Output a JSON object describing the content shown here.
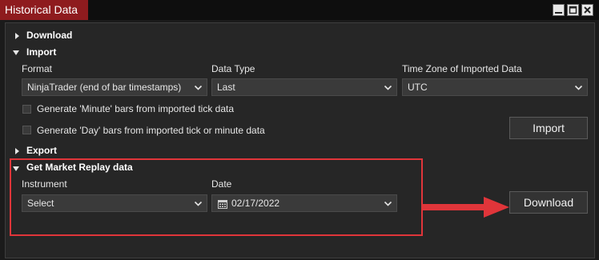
{
  "window": {
    "title": "Historical Data"
  },
  "sections": {
    "download": "Download",
    "import": "Import",
    "export": "Export",
    "replay": "Get Market Replay data"
  },
  "import": {
    "format_label": "Format",
    "format_value": "NinjaTrader (end of bar timestamps)",
    "datatype_label": "Data Type",
    "datatype_value": "Last",
    "timezone_label": "Time Zone of Imported Data",
    "timezone_value": "UTC",
    "minute_bars_label": "Generate 'Minute' bars from imported tick data",
    "day_bars_label": "Generate 'Day' bars from imported tick or minute data",
    "button": "Import"
  },
  "replay": {
    "instrument_label": "Instrument",
    "instrument_value": "Select",
    "date_label": "Date",
    "date_value": "02/17/2022",
    "button": "Download"
  },
  "colors": {
    "accent": "#8e1b1e",
    "highlight": "#e0353a"
  }
}
